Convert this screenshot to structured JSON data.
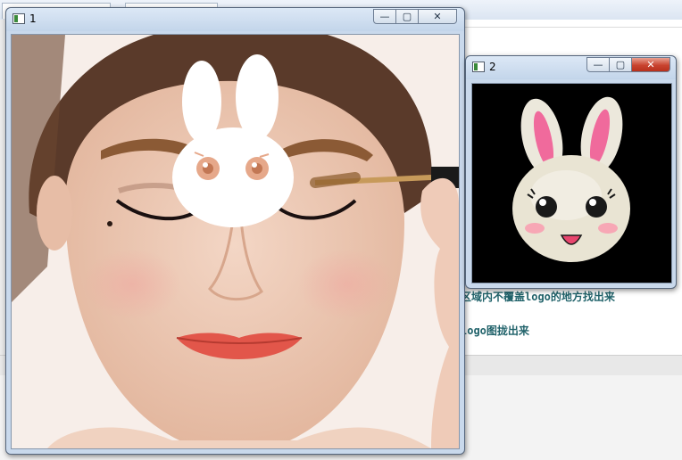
{
  "background": {
    "tab_labels": [
      "",
      ""
    ],
    "code_lines": [
      "区域内不覆盖logo的地方找出来",
      "logo图拢出来"
    ]
  },
  "window1": {
    "title": "1",
    "minimize_label": "—",
    "maximize_label": "▢",
    "close_label": "✕"
  },
  "window2": {
    "title": "2",
    "minimize_label": "—",
    "maximize_label": "▢",
    "close_label": "✕"
  },
  "icons": {
    "window1": "window-app-icon",
    "window2": "window-app-icon"
  },
  "colors": {
    "code_text": "#20626a",
    "close_button": "#c8432f",
    "title_bar": "#c9d9ec"
  }
}
